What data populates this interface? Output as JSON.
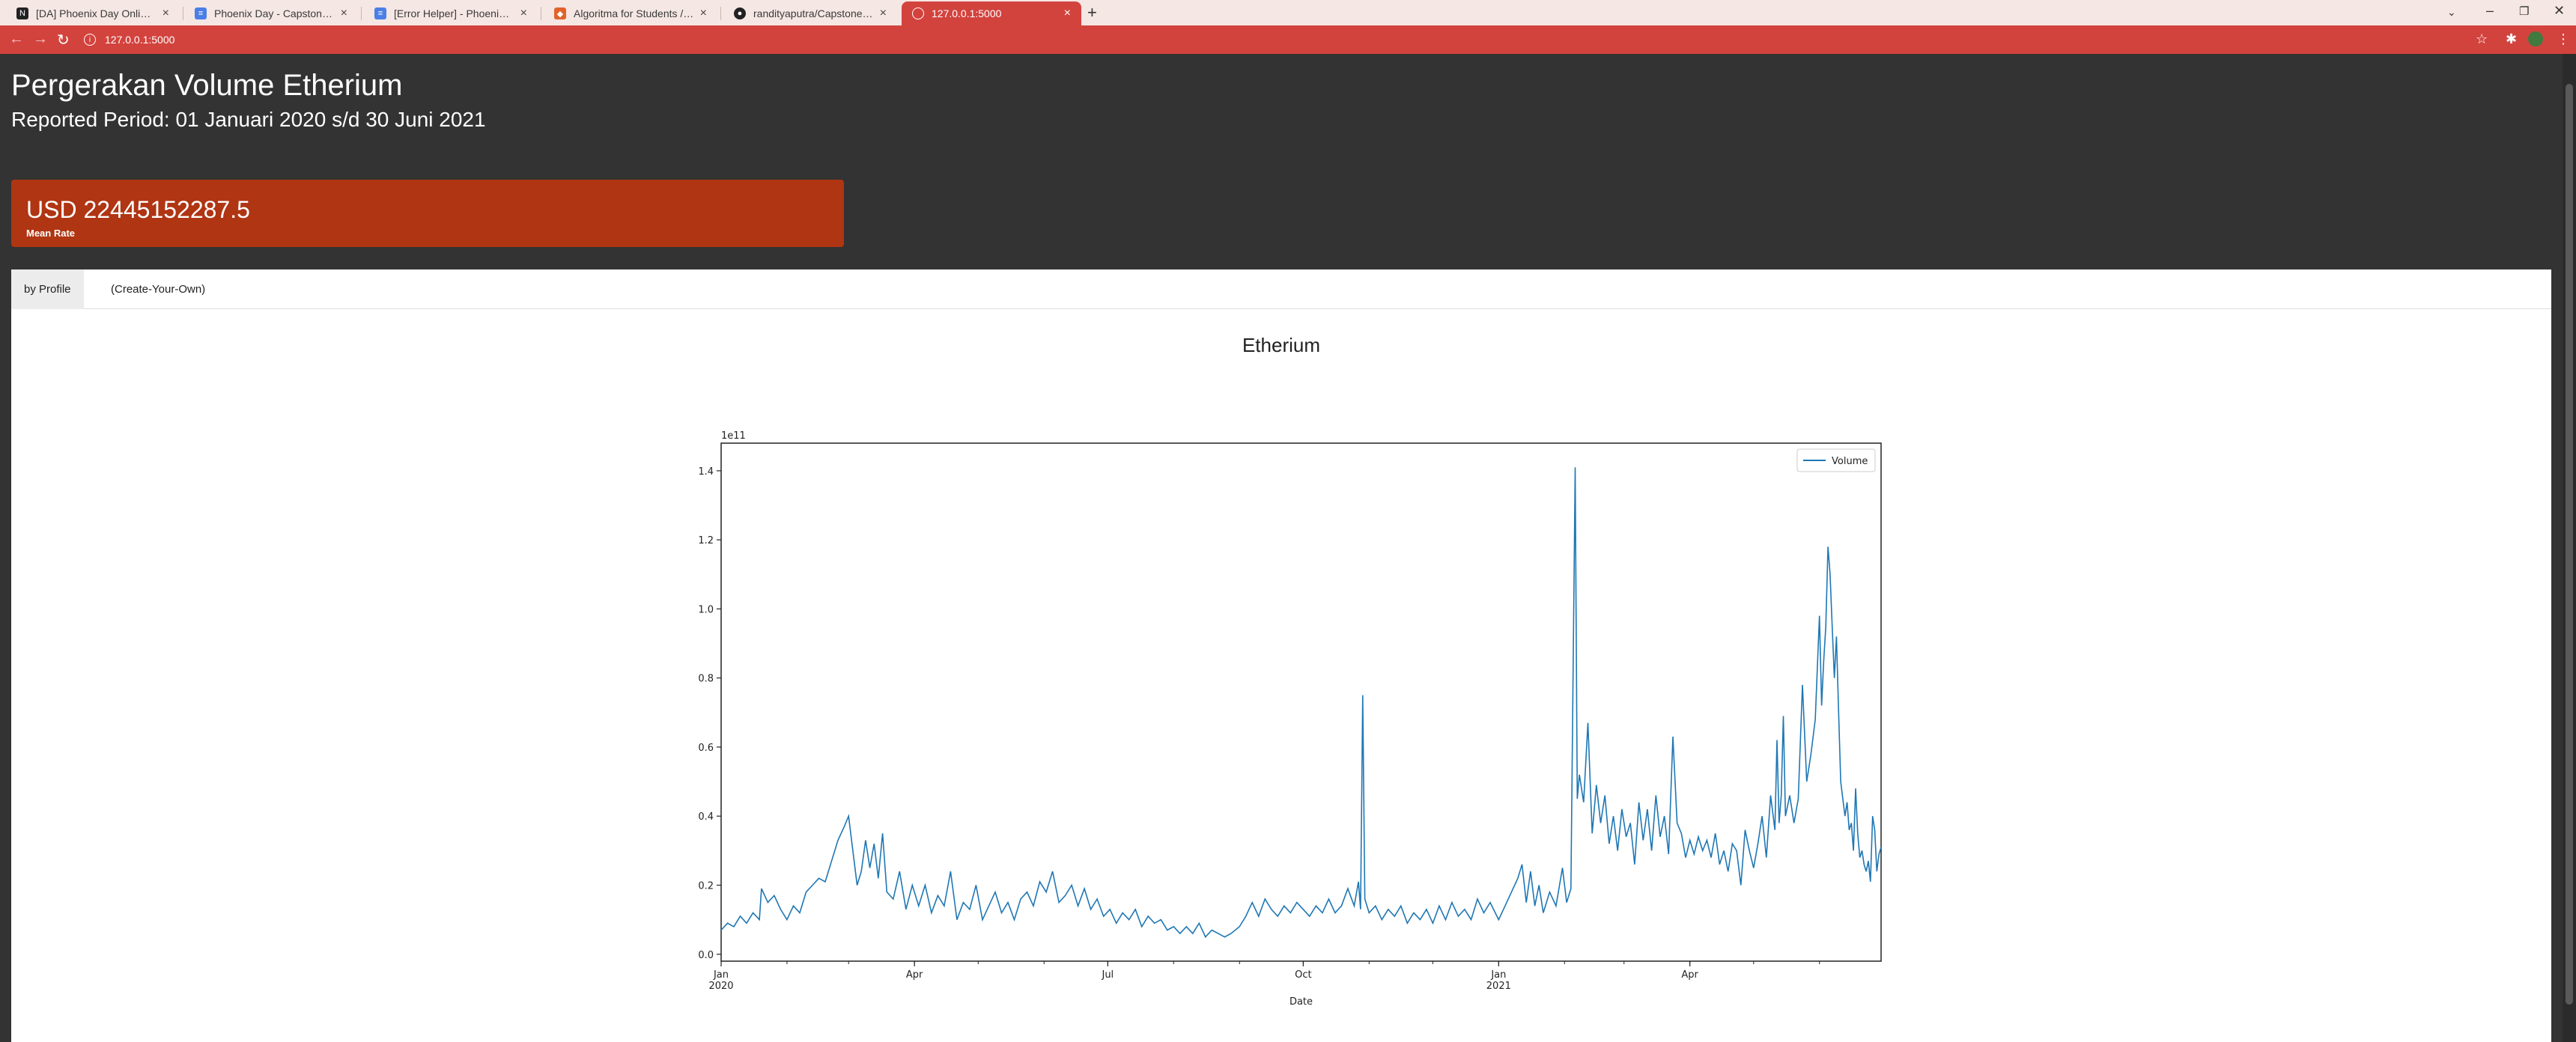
{
  "browser": {
    "tabs": [
      {
        "title": "[DA] Phoenix Day Online Algorit",
        "icon": "notion-icon",
        "color": "#222222"
      },
      {
        "title": "Phoenix Day - Capstone Data An",
        "icon": "docs-icon",
        "color": "#4a7fe8"
      },
      {
        "title": "[Error Helper] - Phoenix Day Onl",
        "icon": "docs-icon",
        "color": "#4a7fe8"
      },
      {
        "title": "Algoritma for Students / Academ",
        "icon": "gitlab-icon",
        "color": "#e2622a"
      },
      {
        "title": "randityaputra/Capstone_webscr",
        "icon": "github-icon",
        "color": "#222222"
      },
      {
        "title": "127.0.0.1:5000",
        "icon": "globe-icon",
        "color": "#ffffff"
      }
    ],
    "url": "127.0.0.1:5000"
  },
  "header": {
    "title": "Pergerakan Volume Etherium",
    "period": "Reported Period: 01 Januari 2020 s/d 30 Juni 2021"
  },
  "card": {
    "value": "USD 22445152287.5",
    "label": "Mean Rate",
    "color": "#b03512"
  },
  "panel_tabs": [
    "by Profile",
    "(Create-Your-Own)"
  ],
  "chart_title": "Etherium",
  "chart_data": {
    "type": "line",
    "title": "Etherium",
    "xlabel": "Date",
    "ylabel": "",
    "y_offset_label": "1e11",
    "ylim": [
      -0.02,
      1.48
    ],
    "yticks": [
      "0.0",
      "0.2",
      "0.4",
      "0.6",
      "0.8",
      "1.0",
      "1.2",
      "1.4"
    ],
    "xlim": [
      "2020-01-01",
      "2021-06-30"
    ],
    "xticks": [
      {
        "date": "2020-01-01",
        "label": "Jan",
        "sub": "2020"
      },
      {
        "date": "2020-04-01",
        "label": "Apr",
        "sub": ""
      },
      {
        "date": "2020-07-01",
        "label": "Jul",
        "sub": ""
      },
      {
        "date": "2020-10-01",
        "label": "Oct",
        "sub": ""
      },
      {
        "date": "2021-01-01",
        "label": "Jan",
        "sub": "2021"
      },
      {
        "date": "2021-04-01",
        "label": "Apr",
        "sub": ""
      }
    ],
    "legend": "top-right",
    "series": [
      {
        "name": "Volume",
        "color": "#1f77b4",
        "points": [
          [
            "2020-01-01",
            0.07
          ],
          [
            "2020-01-04",
            0.09
          ],
          [
            "2020-01-07",
            0.08
          ],
          [
            "2020-01-10",
            0.11
          ],
          [
            "2020-01-13",
            0.09
          ],
          [
            "2020-01-16",
            0.12
          ],
          [
            "2020-01-19",
            0.1
          ],
          [
            "2020-01-20",
            0.19
          ],
          [
            "2020-01-23",
            0.15
          ],
          [
            "2020-01-26",
            0.17
          ],
          [
            "2020-01-29",
            0.13
          ],
          [
            "2020-02-01",
            0.1
          ],
          [
            "2020-02-04",
            0.14
          ],
          [
            "2020-02-07",
            0.12
          ],
          [
            "2020-02-10",
            0.18
          ],
          [
            "2020-02-13",
            0.2
          ],
          [
            "2020-02-16",
            0.22
          ],
          [
            "2020-02-19",
            0.21
          ],
          [
            "2020-02-22",
            0.27
          ],
          [
            "2020-02-25",
            0.33
          ],
          [
            "2020-02-28",
            0.37
          ],
          [
            "2020-03-01",
            0.4
          ],
          [
            "2020-03-03",
            0.3
          ],
          [
            "2020-03-05",
            0.2
          ],
          [
            "2020-03-07",
            0.24
          ],
          [
            "2020-03-09",
            0.33
          ],
          [
            "2020-03-11",
            0.25
          ],
          [
            "2020-03-13",
            0.32
          ],
          [
            "2020-03-15",
            0.22
          ],
          [
            "2020-03-17",
            0.35
          ],
          [
            "2020-03-19",
            0.18
          ],
          [
            "2020-03-22",
            0.16
          ],
          [
            "2020-03-25",
            0.24
          ],
          [
            "2020-03-28",
            0.13
          ],
          [
            "2020-03-31",
            0.2
          ],
          [
            "2020-04-03",
            0.14
          ],
          [
            "2020-04-06",
            0.2
          ],
          [
            "2020-04-09",
            0.12
          ],
          [
            "2020-04-12",
            0.17
          ],
          [
            "2020-04-15",
            0.14
          ],
          [
            "2020-04-18",
            0.24
          ],
          [
            "2020-04-21",
            0.1
          ],
          [
            "2020-04-24",
            0.15
          ],
          [
            "2020-04-27",
            0.13
          ],
          [
            "2020-04-30",
            0.2
          ],
          [
            "2020-05-03",
            0.1
          ],
          [
            "2020-05-06",
            0.14
          ],
          [
            "2020-05-09",
            0.18
          ],
          [
            "2020-05-12",
            0.12
          ],
          [
            "2020-05-15",
            0.15
          ],
          [
            "2020-05-18",
            0.1
          ],
          [
            "2020-05-21",
            0.16
          ],
          [
            "2020-05-24",
            0.18
          ],
          [
            "2020-05-27",
            0.14
          ],
          [
            "2020-05-30",
            0.21
          ],
          [
            "2020-06-02",
            0.18
          ],
          [
            "2020-06-05",
            0.24
          ],
          [
            "2020-06-08",
            0.15
          ],
          [
            "2020-06-11",
            0.17
          ],
          [
            "2020-06-14",
            0.2
          ],
          [
            "2020-06-17",
            0.14
          ],
          [
            "2020-06-20",
            0.19
          ],
          [
            "2020-06-23",
            0.13
          ],
          [
            "2020-06-26",
            0.16
          ],
          [
            "2020-06-29",
            0.11
          ],
          [
            "2020-07-02",
            0.13
          ],
          [
            "2020-07-05",
            0.09
          ],
          [
            "2020-07-08",
            0.12
          ],
          [
            "2020-07-11",
            0.1
          ],
          [
            "2020-07-14",
            0.13
          ],
          [
            "2020-07-17",
            0.08
          ],
          [
            "2020-07-20",
            0.11
          ],
          [
            "2020-07-23",
            0.09
          ],
          [
            "2020-07-26",
            0.1
          ],
          [
            "2020-07-29",
            0.07
          ],
          [
            "2020-08-01",
            0.08
          ],
          [
            "2020-08-04",
            0.06
          ],
          [
            "2020-08-07",
            0.08
          ],
          [
            "2020-08-10",
            0.06
          ],
          [
            "2020-08-13",
            0.09
          ],
          [
            "2020-08-16",
            0.05
          ],
          [
            "2020-08-19",
            0.07
          ],
          [
            "2020-08-22",
            0.06
          ],
          [
            "2020-08-25",
            0.05
          ],
          [
            "2020-08-28",
            0.06
          ],
          [
            "2020-09-01",
            0.08
          ],
          [
            "2020-09-04",
            0.11
          ],
          [
            "2020-09-07",
            0.15
          ],
          [
            "2020-09-10",
            0.11
          ],
          [
            "2020-09-13",
            0.16
          ],
          [
            "2020-09-16",
            0.13
          ],
          [
            "2020-09-19",
            0.11
          ],
          [
            "2020-09-22",
            0.14
          ],
          [
            "2020-09-25",
            0.12
          ],
          [
            "2020-09-28",
            0.15
          ],
          [
            "2020-10-01",
            0.13
          ],
          [
            "2020-10-04",
            0.11
          ],
          [
            "2020-10-07",
            0.14
          ],
          [
            "2020-10-10",
            0.12
          ],
          [
            "2020-10-13",
            0.16
          ],
          [
            "2020-10-16",
            0.12
          ],
          [
            "2020-10-19",
            0.14
          ],
          [
            "2020-10-22",
            0.19
          ],
          [
            "2020-10-25",
            0.14
          ],
          [
            "2020-10-27",
            0.21
          ],
          [
            "2020-10-28",
            0.13
          ],
          [
            "2020-10-29",
            0.75
          ],
          [
            "2020-10-30",
            0.16
          ],
          [
            "2020-11-01",
            0.12
          ],
          [
            "2020-11-04",
            0.14
          ],
          [
            "2020-11-07",
            0.1
          ],
          [
            "2020-11-10",
            0.13
          ],
          [
            "2020-11-13",
            0.11
          ],
          [
            "2020-11-16",
            0.14
          ],
          [
            "2020-11-19",
            0.09
          ],
          [
            "2020-11-22",
            0.12
          ],
          [
            "2020-11-25",
            0.1
          ],
          [
            "2020-11-28",
            0.13
          ],
          [
            "2020-12-01",
            0.09
          ],
          [
            "2020-12-04",
            0.14
          ],
          [
            "2020-12-07",
            0.1
          ],
          [
            "2020-12-10",
            0.15
          ],
          [
            "2020-12-13",
            0.11
          ],
          [
            "2020-12-16",
            0.13
          ],
          [
            "2020-12-19",
            0.1
          ],
          [
            "2020-12-22",
            0.16
          ],
          [
            "2020-12-25",
            0.12
          ],
          [
            "2020-12-28",
            0.15
          ],
          [
            "2021-01-01",
            0.1
          ],
          [
            "2021-01-04",
            0.14
          ],
          [
            "2021-01-07",
            0.18
          ],
          [
            "2021-01-10",
            0.22
          ],
          [
            "2021-01-12",
            0.26
          ],
          [
            "2021-01-14",
            0.15
          ],
          [
            "2021-01-16",
            0.24
          ],
          [
            "2021-01-18",
            0.14
          ],
          [
            "2021-01-20",
            0.2
          ],
          [
            "2021-01-22",
            0.12
          ],
          [
            "2021-01-25",
            0.18
          ],
          [
            "2021-01-28",
            0.14
          ],
          [
            "2021-01-31",
            0.25
          ],
          [
            "2021-02-02",
            0.15
          ],
          [
            "2021-02-04",
            0.19
          ],
          [
            "2021-02-06",
            1.41
          ],
          [
            "2021-02-07",
            0.45
          ],
          [
            "2021-02-08",
            0.52
          ],
          [
            "2021-02-10",
            0.44
          ],
          [
            "2021-02-12",
            0.67
          ],
          [
            "2021-02-14",
            0.35
          ],
          [
            "2021-02-16",
            0.49
          ],
          [
            "2021-02-18",
            0.38
          ],
          [
            "2021-02-20",
            0.46
          ],
          [
            "2021-02-22",
            0.32
          ],
          [
            "2021-02-24",
            0.4
          ],
          [
            "2021-02-26",
            0.3
          ],
          [
            "2021-02-28",
            0.42
          ],
          [
            "2021-03-02",
            0.34
          ],
          [
            "2021-03-04",
            0.38
          ],
          [
            "2021-03-06",
            0.26
          ],
          [
            "2021-03-08",
            0.44
          ],
          [
            "2021-03-10",
            0.33
          ],
          [
            "2021-03-12",
            0.42
          ],
          [
            "2021-03-14",
            0.3
          ],
          [
            "2021-03-16",
            0.46
          ],
          [
            "2021-03-18",
            0.34
          ],
          [
            "2021-03-20",
            0.4
          ],
          [
            "2021-03-22",
            0.29
          ],
          [
            "2021-03-24",
            0.63
          ],
          [
            "2021-03-26",
            0.38
          ],
          [
            "2021-03-28",
            0.35
          ],
          [
            "2021-03-30",
            0.28
          ],
          [
            "2021-04-01",
            0.33
          ],
          [
            "2021-04-03",
            0.29
          ],
          [
            "2021-04-05",
            0.34
          ],
          [
            "2021-04-07",
            0.3
          ],
          [
            "2021-04-09",
            0.33
          ],
          [
            "2021-04-11",
            0.28
          ],
          [
            "2021-04-13",
            0.35
          ],
          [
            "2021-04-15",
            0.26
          ],
          [
            "2021-04-17",
            0.3
          ],
          [
            "2021-04-19",
            0.24
          ],
          [
            "2021-04-21",
            0.32
          ],
          [
            "2021-04-23",
            0.3
          ],
          [
            "2021-04-25",
            0.2
          ],
          [
            "2021-04-27",
            0.36
          ],
          [
            "2021-04-29",
            0.3
          ],
          [
            "2021-05-01",
            0.25
          ],
          [
            "2021-05-03",
            0.32
          ],
          [
            "2021-05-05",
            0.4
          ],
          [
            "2021-05-07",
            0.28
          ],
          [
            "2021-05-09",
            0.46
          ],
          [
            "2021-05-11",
            0.36
          ],
          [
            "2021-05-12",
            0.62
          ],
          [
            "2021-05-13",
            0.38
          ],
          [
            "2021-05-14",
            0.46
          ],
          [
            "2021-05-15",
            0.69
          ],
          [
            "2021-05-16",
            0.4
          ],
          [
            "2021-05-18",
            0.46
          ],
          [
            "2021-05-20",
            0.38
          ],
          [
            "2021-05-22",
            0.45
          ],
          [
            "2021-05-24",
            0.78
          ],
          [
            "2021-05-26",
            0.5
          ],
          [
            "2021-05-28",
            0.58
          ],
          [
            "2021-05-30",
            0.68
          ],
          [
            "2021-06-01",
            0.98
          ],
          [
            "2021-06-02",
            0.72
          ],
          [
            "2021-06-03",
            0.85
          ],
          [
            "2021-06-04",
            0.95
          ],
          [
            "2021-06-05",
            1.18
          ],
          [
            "2021-06-06",
            1.1
          ],
          [
            "2021-06-07",
            0.95
          ],
          [
            "2021-06-08",
            0.8
          ],
          [
            "2021-06-09",
            0.92
          ],
          [
            "2021-06-10",
            0.7
          ],
          [
            "2021-06-11",
            0.5
          ],
          [
            "2021-06-12",
            0.45
          ],
          [
            "2021-06-13",
            0.4
          ],
          [
            "2021-06-14",
            0.44
          ],
          [
            "2021-06-15",
            0.36
          ],
          [
            "2021-06-16",
            0.38
          ],
          [
            "2021-06-17",
            0.3
          ],
          [
            "2021-06-18",
            0.48
          ],
          [
            "2021-06-19",
            0.35
          ],
          [
            "2021-06-20",
            0.28
          ],
          [
            "2021-06-21",
            0.3
          ],
          [
            "2021-06-22",
            0.26
          ],
          [
            "2021-06-23",
            0.24
          ],
          [
            "2021-06-24",
            0.27
          ],
          [
            "2021-06-25",
            0.21
          ],
          [
            "2021-06-26",
            0.4
          ],
          [
            "2021-06-27",
            0.36
          ],
          [
            "2021-06-28",
            0.24
          ],
          [
            "2021-06-29",
            0.29
          ],
          [
            "2021-06-30",
            0.31
          ]
        ]
      }
    ]
  }
}
